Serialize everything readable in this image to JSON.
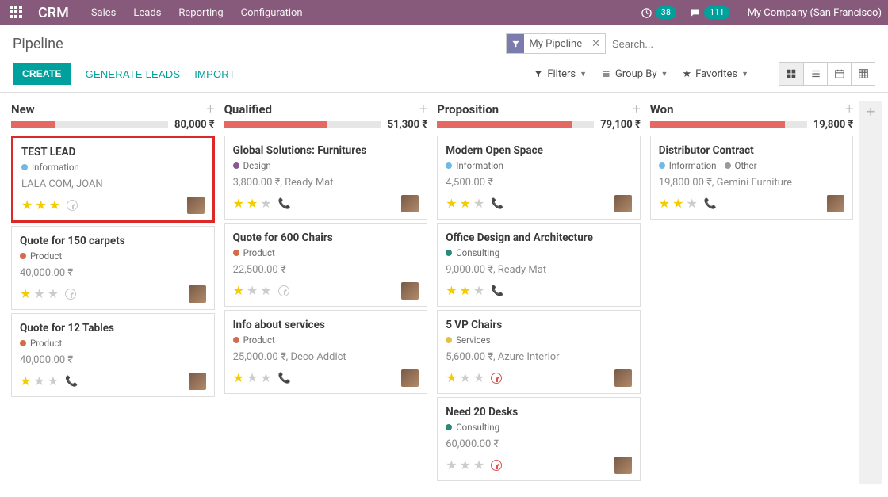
{
  "nav": {
    "brand": "CRM",
    "links": [
      "Sales",
      "Leads",
      "Reporting",
      "Configuration"
    ],
    "activity_badge": "38",
    "chat_badge": "111",
    "company": "My Company (San Francisco)"
  },
  "cp": {
    "title": "Pipeline",
    "facet": "My Pipeline",
    "search_placeholder": "Search...",
    "create": "CREATE",
    "generate": "GENERATE LEADS",
    "import": "IMPORT",
    "filters": "Filters",
    "groupby": "Group By",
    "favorites": "Favorites"
  },
  "tag_colors": {
    "Information": "#6fb8e8",
    "Design": "#8a5a8f",
    "Product": "#d46a4e",
    "Consulting": "#2a8a7a",
    "Services": "#e3c04a",
    "Other": "#9a9a9a"
  },
  "columns": [
    {
      "title": "New",
      "amount": "80,000 ₹",
      "fill": 28,
      "cards": [
        {
          "title": "TEST LEAD",
          "tags": [
            "Information"
          ],
          "sub": "LALA COM, JOAN",
          "stars": 3,
          "extra": "clock",
          "avatar": true,
          "hl": true
        },
        {
          "title": "Quote for 150 carpets",
          "tags": [
            "Product"
          ],
          "sub": "40,000.00 ₹",
          "stars": 1,
          "extra": "clock",
          "avatar": true
        },
        {
          "title": "Quote for 12 Tables",
          "tags": [
            "Product"
          ],
          "sub": "40,000.00 ₹",
          "stars": 1,
          "extra": "phone",
          "avatar": true
        }
      ]
    },
    {
      "title": "Qualified",
      "amount": "51,300 ₹",
      "fill": 66,
      "cards": [
        {
          "title": "Global Solutions: Furnitures",
          "tags": [
            "Design"
          ],
          "sub": "3,800.00 ₹, Ready Mat",
          "stars": 2,
          "extra": "phone",
          "avatar": true
        },
        {
          "title": "Quote for 600 Chairs",
          "tags": [
            "Product"
          ],
          "sub": "22,500.00 ₹",
          "stars": 1,
          "extra": "clock",
          "avatar": true
        },
        {
          "title": "Info about services",
          "tags": [
            "Product"
          ],
          "sub": "25,000.00 ₹, Deco Addict",
          "stars": 1,
          "extra": "phone",
          "avatar": true
        }
      ]
    },
    {
      "title": "Proposition",
      "amount": "79,100 ₹",
      "fill": 86,
      "cards": [
        {
          "title": "Modern Open Space",
          "tags": [
            "Information"
          ],
          "sub": "4,500.00 ₹",
          "stars": 2,
          "extra": "phone",
          "avatar": true
        },
        {
          "title": "Office Design and Architecture",
          "tags": [
            "Consulting"
          ],
          "sub": "9,000.00 ₹, Ready Mat",
          "stars": 2,
          "extra": "phone",
          "avatar": false
        },
        {
          "title": "5 VP Chairs",
          "tags": [
            "Services"
          ],
          "sub": "5,600.00 ₹, Azure Interior",
          "stars": 1,
          "extra": "redclock",
          "avatar": true
        },
        {
          "title": "Need 20 Desks",
          "tags": [
            "Consulting"
          ],
          "sub": "60,000.00 ₹",
          "stars": 0,
          "extra": "redclock",
          "avatar": true
        }
      ]
    },
    {
      "title": "Won",
      "amount": "19,800 ₹",
      "fill": 86,
      "cards": [
        {
          "title": "Distributor Contract",
          "tags": [
            "Information",
            "Other"
          ],
          "sub": "19,800.00 ₹, Gemini Furniture",
          "stars": 2,
          "extra": "phone",
          "avatar": true
        }
      ]
    }
  ]
}
